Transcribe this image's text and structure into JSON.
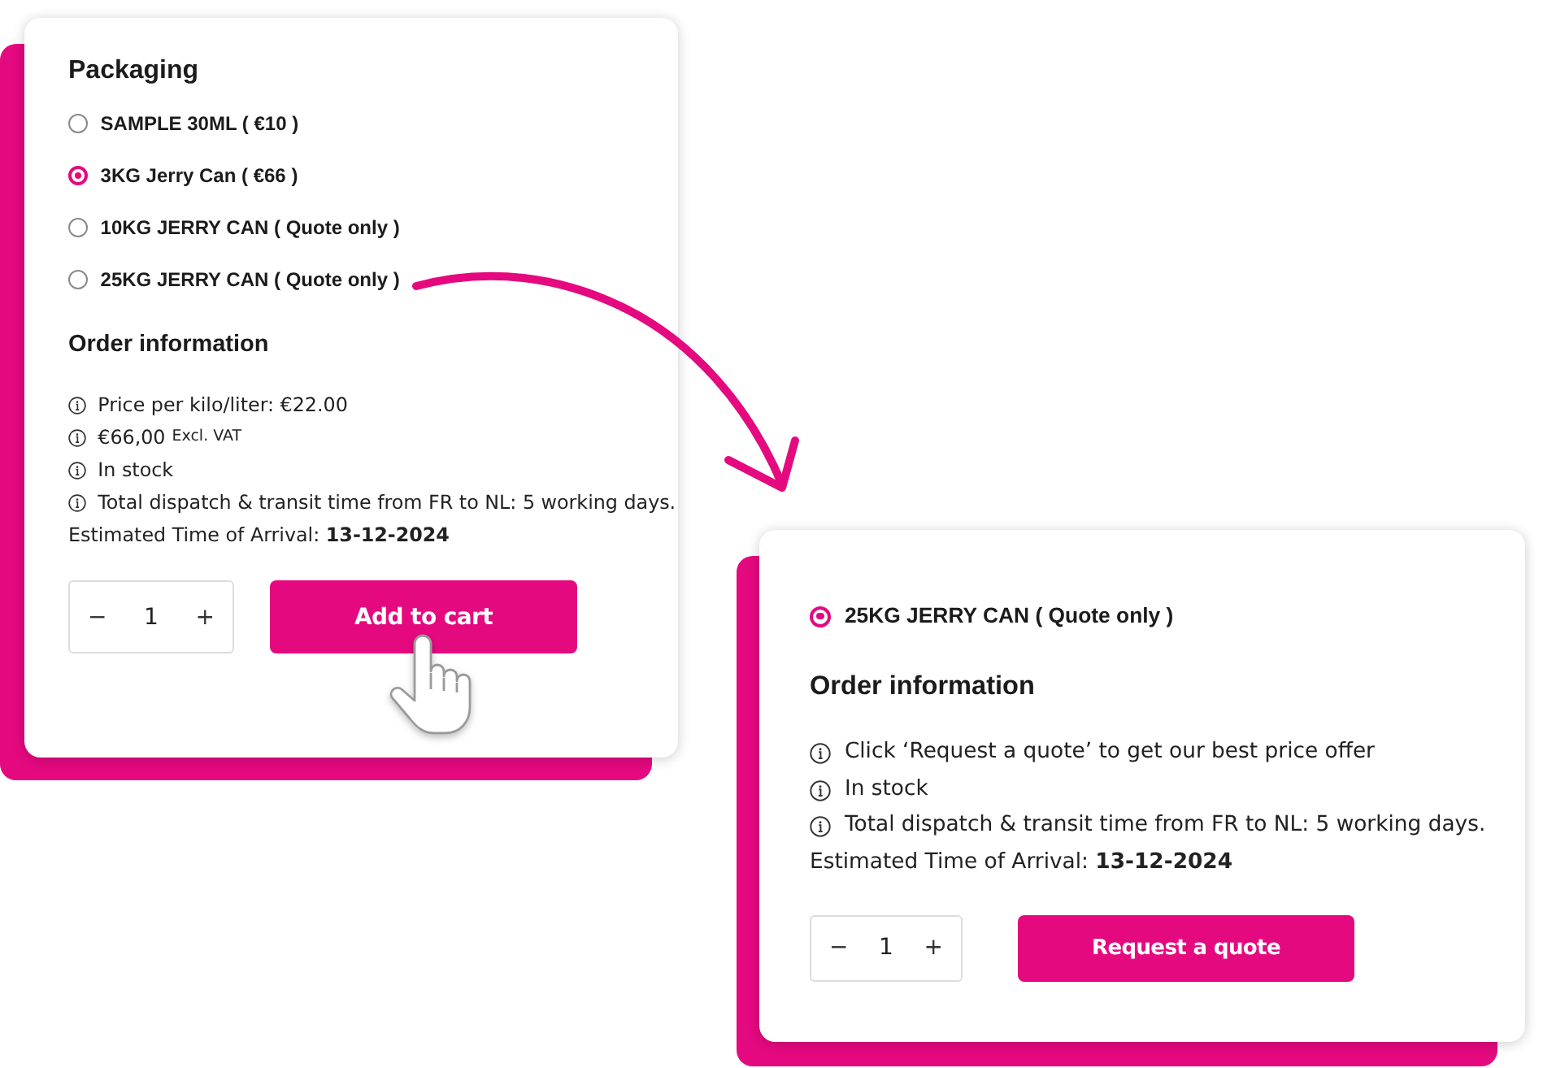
{
  "cards": [
    {
      "section_title": "Packaging",
      "options": [
        {
          "label": "SAMPLE 30ML ( €10 )",
          "selected": false
        },
        {
          "label": "3KG Jerry Can ( €66 )",
          "selected": true
        },
        {
          "label": "10KG JERRY CAN ( Quote only )",
          "selected": false
        },
        {
          "label": "25KG JERRY CAN ( Quote only )",
          "selected": false
        }
      ],
      "order_title": "Order information",
      "info": [
        {
          "text": "Price per kilo/liter: €22.00"
        },
        {
          "text": "€66,00",
          "note": "Excl. VAT"
        },
        {
          "text": "In stock"
        },
        {
          "text": "Total dispatch & transit time from FR to NL: 5 working days."
        }
      ],
      "arrival": "Estimated Time of Arrival: **13-12-2024**",
      "quantity": {
        "decrease": "−",
        "value": "1",
        "increase": "+"
      },
      "button": "Add to cart"
    },
    {
      "options": [
        {
          "label": "25KG JERRY CAN ( Quote only )",
          "selected": true
        }
      ],
      "order_title": "Order information",
      "info": [
        {
          "text": "Click ‘Request a quote’ to get our best price offer"
        },
        {
          "text": "In stock"
        },
        {
          "text": "Total dispatch & transit time from FR to NL: 5 working days."
        }
      ],
      "arrival": "Estimated Time of Arrival: **13-12-2024**",
      "quantity": {
        "decrease": "−",
        "value": "1",
        "increase": "+"
      },
      "button": "Request a quote"
    }
  ]
}
